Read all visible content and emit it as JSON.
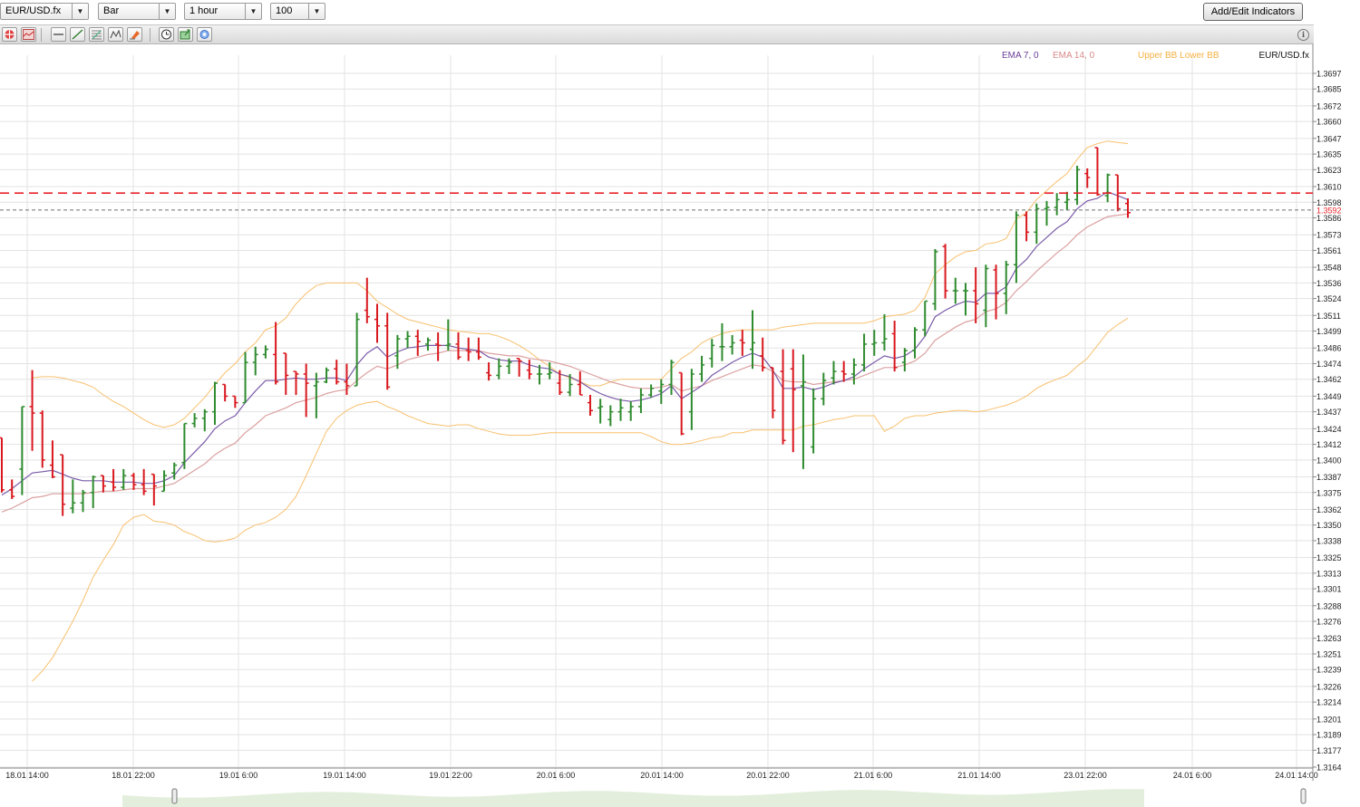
{
  "toolbar": {
    "symbol": "EUR/USD.fx",
    "chart_type": "Bar",
    "interval": "1 hour",
    "bars": "100",
    "add_indicators_label": "Add/Edit Indicators",
    "buttons": [
      "crosshair-icon",
      "line-chart-icon",
      "horizontal-line-icon",
      "trend-line-icon",
      "fibonacci-icon",
      "pattern-icon",
      "eraser-icon",
      "clock-icon",
      "export-icon",
      "settings-icon"
    ]
  },
  "legend": {
    "ema7": "EMA 7, 0",
    "ema14": "EMA 14, 0",
    "bb": "Upper BB Lower BB",
    "symbol": "EUR/USD.fx",
    "ema7_color": "#6a3d9a",
    "ema14_color": "#d98a8a",
    "bb_color": "#f5b041"
  },
  "colors": {
    "up": "#2e8b2e",
    "down": "#d9181e",
    "ema7": "#7b5ba8",
    "ema14": "#dba0a0",
    "bb": "#f8c06e",
    "hline": "#e8232a",
    "current_line": "#707070",
    "grid": "#e3e3e3"
  },
  "chart_data": {
    "type": "ohlc",
    "price_axis_labels": [
      "1.3697",
      "1.3685",
      "1.3672",
      "1.3660",
      "1.3647",
      "1.3635",
      "1.3623",
      "1.3610",
      "1.3598",
      "1.3586",
      "1.3573",
      "1.3561",
      "1.3548",
      "1.3536",
      "1.3524",
      "1.3511",
      "1.3499",
      "1.3486",
      "1.3474",
      "1.3462",
      "1.3449",
      "1.3437",
      "1.3424",
      "1.3412",
      "1.3400",
      "1.3387",
      "1.3375",
      "1.3362",
      "1.3350",
      "1.3338",
      "1.3325",
      "1.3313",
      "1.3301",
      "1.3288",
      "1.3276",
      "1.3263",
      "1.3251",
      "1.3239",
      "1.3226",
      "1.3214",
      "1.3201",
      "1.3189",
      "1.3177",
      "1.3164"
    ],
    "ylim": [
      1.3164,
      1.3697
    ],
    "time_axis_labels": [
      "18.01 14:00",
      "18.01 22:00",
      "19.01 6:00",
      "19.01 14:00",
      "19.01 22:00",
      "20.01 6:00",
      "20.01 14:00",
      "20.01 22:00",
      "21.01 6:00",
      "21.01 14:00",
      "23.01 22:00",
      "24.01 6:00",
      "24.01 14:00"
    ],
    "current_price": "1.3592",
    "current_price_value": 1.3592,
    "horizontal_line": 1.3605,
    "ohlc": [
      [
        1.3417,
        1.3417,
        1.3375,
        1.3377
      ],
      [
        1.3377,
        1.3385,
        1.337,
        1.3372
      ],
      [
        1.3393,
        1.3441,
        1.3373,
        1.3441
      ],
      [
        1.3441,
        1.3469,
        1.3407,
        1.3436
      ],
      [
        1.3436,
        1.3438,
        1.3394,
        1.34
      ],
      [
        1.3396,
        1.3415,
        1.3386,
        1.3387
      ],
      [
        1.3404,
        1.3404,
        1.3357,
        1.3366
      ],
      [
        1.3363,
        1.3385,
        1.3359,
        1.3367
      ],
      [
        1.3367,
        1.3377,
        1.336,
        1.3375
      ],
      [
        1.3375,
        1.3388,
        1.3363,
        1.3387
      ],
      [
        1.3388,
        1.3388,
        1.3375,
        1.338
      ],
      [
        1.3383,
        1.3393,
        1.3376,
        1.3379
      ],
      [
        1.3379,
        1.3393,
        1.3377,
        1.3388
      ],
      [
        1.3388,
        1.339,
        1.3377,
        1.3381
      ],
      [
        1.3381,
        1.3393,
        1.3373,
        1.3376
      ],
      [
        1.3389,
        1.3389,
        1.3365,
        1.338
      ],
      [
        1.3376,
        1.3392,
        1.3376,
        1.3388
      ],
      [
        1.339,
        1.3398,
        1.3385,
        1.3396
      ],
      [
        1.3398,
        1.3428,
        1.3393,
        1.3428
      ],
      [
        1.3428,
        1.3436,
        1.3425,
        1.3432
      ],
      [
        1.3432,
        1.3439,
        1.3422,
        1.3437
      ],
      [
        1.3437,
        1.346,
        1.3427,
        1.3459
      ],
      [
        1.3458,
        1.3458,
        1.3445,
        1.3449
      ],
      [
        1.3449,
        1.3449,
        1.344,
        1.3444
      ],
      [
        1.3444,
        1.3483,
        1.3444,
        1.3475
      ],
      [
        1.3475,
        1.3487,
        1.3465,
        1.3481
      ],
      [
        1.3481,
        1.3488,
        1.3478,
        1.3485
      ],
      [
        1.3481,
        1.3506,
        1.3458,
        1.346
      ],
      [
        1.3482,
        1.3482,
        1.345,
        1.3465
      ],
      [
        1.3468,
        1.3468,
        1.345,
        1.3466
      ],
      [
        1.3466,
        1.3474,
        1.3433,
        1.3459
      ],
      [
        1.3457,
        1.3467,
        1.3432,
        1.346
      ],
      [
        1.346,
        1.3471,
        1.3459,
        1.3469
      ],
      [
        1.347,
        1.3477,
        1.3458,
        1.346
      ],
      [
        1.346,
        1.3474,
        1.345,
        1.3457
      ],
      [
        1.3457,
        1.3513,
        1.3457,
        1.3508
      ],
      [
        1.3515,
        1.354,
        1.3505,
        1.351
      ],
      [
        1.3508,
        1.352,
        1.349,
        1.3503
      ],
      [
        1.3503,
        1.3513,
        1.3454,
        1.3456
      ],
      [
        1.348,
        1.3496,
        1.347,
        1.3493
      ],
      [
        1.3493,
        1.3499,
        1.3486,
        1.3495
      ],
      [
        1.3495,
        1.35,
        1.348,
        1.3491
      ],
      [
        1.3489,
        1.3494,
        1.3484,
        1.3492
      ],
      [
        1.3489,
        1.3498,
        1.3476,
        1.3488
      ],
      [
        1.3488,
        1.3508,
        1.3484,
        1.3489
      ],
      [
        1.3489,
        1.3498,
        1.3477,
        1.3479
      ],
      [
        1.3484,
        1.3494,
        1.3476,
        1.3483
      ],
      [
        1.3483,
        1.3494,
        1.3477,
        1.3479
      ],
      [
        1.3467,
        1.3475,
        1.3461,
        1.3465
      ],
      [
        1.3465,
        1.3478,
        1.3462,
        1.3472
      ],
      [
        1.3472,
        1.3478,
        1.3466,
        1.3475
      ],
      [
        1.3478,
        1.3478,
        1.3464,
        1.3476
      ],
      [
        1.3469,
        1.3477,
        1.3462,
        1.3466
      ],
      [
        1.3466,
        1.3473,
        1.3458,
        1.3466
      ],
      [
        1.3466,
        1.3475,
        1.3462,
        1.3467
      ],
      [
        1.3459,
        1.3469,
        1.345,
        1.3452
      ],
      [
        1.3452,
        1.3466,
        1.3449,
        1.3458
      ],
      [
        1.3458,
        1.3468,
        1.345,
        1.345
      ],
      [
        1.3444,
        1.345,
        1.3434,
        1.3438
      ],
      [
        1.344,
        1.3447,
        1.3428,
        1.3441
      ],
      [
        1.3431,
        1.3442,
        1.3426,
        1.3437
      ],
      [
        1.3437,
        1.3447,
        1.343,
        1.344
      ],
      [
        1.3437,
        1.3445,
        1.343,
        1.3441
      ],
      [
        1.3441,
        1.3455,
        1.3436,
        1.345
      ],
      [
        1.345,
        1.3458,
        1.3448,
        1.3455
      ],
      [
        1.3453,
        1.3462,
        1.3443,
        1.3458
      ],
      [
        1.3458,
        1.3477,
        1.345,
        1.3475
      ],
      [
        1.3467,
        1.3467,
        1.3419,
        1.342
      ],
      [
        1.3437,
        1.347,
        1.3423,
        1.3466
      ],
      [
        1.3466,
        1.348,
        1.346,
        1.3473
      ],
      [
        1.3478,
        1.3493,
        1.3471,
        1.3488
      ],
      [
        1.3487,
        1.3505,
        1.3476,
        1.3487
      ],
      [
        1.3487,
        1.3496,
        1.3481,
        1.349
      ],
      [
        1.3492,
        1.35,
        1.348,
        1.349
      ],
      [
        1.3485,
        1.3515,
        1.347,
        1.349
      ],
      [
        1.348,
        1.3494,
        1.3468,
        1.3471
      ],
      [
        1.3471,
        1.3471,
        1.3432,
        1.3438
      ],
      [
        1.3468,
        1.3485,
        1.3412,
        1.3415
      ],
      [
        1.347,
        1.3485,
        1.3406,
        1.3454
      ],
      [
        1.3457,
        1.3481,
        1.3393,
        1.346
      ],
      [
        1.341,
        1.3455,
        1.3405,
        1.3447
      ],
      [
        1.3447,
        1.3467,
        1.3442,
        1.3461
      ],
      [
        1.3463,
        1.3476,
        1.3458,
        1.3468
      ],
      [
        1.3468,
        1.3476,
        1.346,
        1.3466
      ],
      [
        1.3466,
        1.3478,
        1.3458,
        1.3473
      ]
    ],
    "ema7": [
      1.3373,
      1.3378,
      1.3384,
      1.339,
      1.3391,
      1.3392,
      1.3389,
      1.3386,
      1.3384,
      1.3384,
      1.3384,
      1.3383,
      1.3383,
      1.3383,
      1.3382,
      1.3382,
      1.3384,
      1.3388,
      1.3398,
      1.3406,
      1.3414,
      1.3424,
      1.343,
      1.3434,
      1.3444,
      1.3453,
      1.3461,
      1.3461,
      1.3462,
      1.3463,
      1.3462,
      1.3462,
      1.3463,
      1.3463,
      1.3461,
      1.3473,
      1.3482,
      1.3487,
      1.3479,
      1.3483,
      1.3486,
      1.3487,
      1.3488,
      1.3488,
      1.3488,
      1.3486,
      1.3485,
      1.3484,
      1.3479,
      1.3477,
      1.3476,
      1.3476,
      1.3473,
      1.3471,
      1.347,
      1.3466,
      1.3464,
      1.346,
      1.3455,
      1.3451,
      1.3448,
      1.3446,
      1.3445,
      1.3446,
      1.3448,
      1.3451,
      1.3457,
      1.3447,
      1.3452,
      1.3457,
      1.3465,
      1.347,
      1.3475,
      1.3479,
      1.3482,
      1.3479,
      1.3469,
      1.3455,
      1.3455,
      1.3456,
      1.3454,
      1.3456,
      1.3459,
      1.3461,
      1.3464
    ],
    "ema14": [
      1.336,
      1.3363,
      1.3367,
      1.3371,
      1.3372,
      1.3374,
      1.3374,
      1.3374,
      1.3374,
      1.3375,
      1.3376,
      1.3376,
      1.3377,
      1.3378,
      1.3378,
      1.3378,
      1.338,
      1.3382,
      1.3387,
      1.3392,
      1.3397,
      1.3404,
      1.3409,
      1.3413,
      1.3421,
      1.3427,
      1.3434,
      1.3437,
      1.344,
      1.3444,
      1.3446,
      1.3448,
      1.3451,
      1.3453,
      1.3454,
      1.3461,
      1.3467,
      1.3472,
      1.347,
      1.3473,
      1.3477,
      1.3479,
      1.3481,
      1.3482,
      1.3484,
      1.3484,
      1.3484,
      1.3484,
      1.3482,
      1.3481,
      1.348,
      1.348,
      1.3478,
      1.3477,
      1.3476,
      1.3474,
      1.3472,
      1.3469,
      1.3466,
      1.3463,
      1.346,
      1.3458,
      1.3456,
      1.3455,
      1.3455,
      1.3456,
      1.3458,
      1.3453,
      1.3455,
      1.3457,
      1.3461,
      1.3464,
      1.3467,
      1.347,
      1.3473,
      1.3472,
      1.3468,
      1.3461,
      1.346,
      1.346,
      1.3458,
      1.3459,
      1.346,
      1.3461,
      1.3462
    ],
    "bb_upper": [
      null,
      null,
      null,
      1.3463,
      1.3464,
      1.3464,
      1.3463,
      1.3461,
      1.3459,
      1.3456,
      1.345,
      1.3445,
      1.3441,
      1.3436,
      1.3431,
      1.3427,
      1.3425,
      1.3427,
      1.3432,
      1.344,
      1.3448,
      1.3458,
      1.3467,
      1.3474,
      1.3483,
      1.349,
      1.35,
      1.3503,
      1.3509,
      1.352,
      1.3528,
      1.3534,
      1.3536,
      1.3536,
      1.3536,
      1.3536,
      1.353,
      1.3522,
      1.3517,
      1.3512,
      1.3508,
      1.3506,
      1.3504,
      1.3502,
      1.35,
      1.3499,
      1.3498,
      1.3497,
      1.3497,
      1.3495,
      1.3492,
      1.3488,
      1.3483,
      1.3477,
      1.3472,
      1.3466,
      1.3463,
      1.346,
      1.3457,
      1.3457,
      1.346,
      1.3462,
      1.3462,
      1.3462,
      1.3462,
      1.3462,
      1.347,
      1.3478,
      1.3483,
      1.349,
      1.3494,
      1.3497,
      1.3499,
      1.35,
      1.35,
      1.35,
      1.35,
      1.3502,
      1.3503,
      1.3504,
      1.3505,
      1.3505,
      1.3505,
      1.3505,
      1.3505
    ],
    "bb_lower": [
      null,
      null,
      null,
      1.323,
      1.3238,
      1.3248,
      1.3262,
      1.3276,
      1.3292,
      1.331,
      1.3323,
      1.3335,
      1.335,
      1.3356,
      1.3358,
      1.3353,
      1.3352,
      1.335,
      1.3345,
      1.3342,
      1.3338,
      1.3337,
      1.3338,
      1.334,
      1.3346,
      1.335,
      1.3352,
      1.3356,
      1.3362,
      1.3372,
      1.3388,
      1.3405,
      1.3422,
      1.3432,
      1.3438,
      1.3442,
      1.3444,
      1.3445,
      1.3441,
      1.3438,
      1.3434,
      1.3431,
      1.3428,
      1.3427,
      1.3426,
      1.3427,
      1.3427,
      1.3424,
      1.3422,
      1.342,
      1.3419,
      1.3419,
      1.3419,
      1.342,
      1.3421,
      1.3421,
      1.3421,
      1.3421,
      1.3421,
      1.3421,
      1.3421,
      1.3421,
      1.3421,
      1.3421,
      1.3418,
      1.3414,
      1.3412,
      1.3412,
      1.3413,
      1.3415,
      1.3417,
      1.3418,
      1.3421,
      1.3421,
      1.3423,
      1.3423,
      1.3423,
      1.3423,
      1.3423,
      1.3426,
      1.3427,
      1.3429,
      1.3431,
      1.3432,
      1.3434
    ],
    "ohlc_tail": [
      [
        1.3473,
        1.3497,
        1.3468,
        1.3489
      ],
      [
        1.3489,
        1.35,
        1.348,
        1.349
      ],
      [
        1.349,
        1.3512,
        1.3484,
        1.3493
      ],
      [
        1.3497,
        1.3507,
        1.3468,
        1.3471
      ],
      [
        1.3475,
        1.3486,
        1.3468,
        1.3484
      ],
      [
        1.3484,
        1.3502,
        1.3478,
        1.35
      ],
      [
        1.35,
        1.3522,
        1.3495,
        1.3522
      ],
      [
        1.352,
        1.3562,
        1.3515,
        1.356
      ],
      [
        1.3564,
        1.3566,
        1.3524,
        1.353
      ],
      [
        1.353,
        1.354,
        1.352,
        1.353
      ],
      [
        1.353,
        1.3536,
        1.3511,
        1.353
      ],
      [
        1.353,
        1.3548,
        1.3505,
        1.352
      ],
      [
        1.3515,
        1.355,
        1.3502,
        1.3547
      ],
      [
        1.3546,
        1.355,
        1.3508,
        1.3528
      ],
      [
        1.3528,
        1.3553,
        1.3512,
        1.355
      ],
      [
        1.355,
        1.3591,
        1.3536,
        1.3588
      ],
      [
        1.3588,
        1.3591,
        1.3568,
        1.3575
      ],
      [
        1.3575,
        1.3597,
        1.3566,
        1.3593
      ],
      [
        1.3593,
        1.3599,
        1.358,
        1.3594
      ],
      [
        1.3594,
        1.3605,
        1.3588,
        1.36
      ],
      [
        1.3598,
        1.3606,
        1.3592,
        1.36
      ],
      [
        1.36,
        1.3626,
        1.3596,
        1.3623
      ],
      [
        1.362,
        1.3624,
        1.3609,
        1.3617
      ],
      [
        1.364,
        1.364,
        1.3603,
        1.3604
      ],
      [
        1.3603,
        1.362,
        1.3598,
        1.3619
      ],
      [
        1.3619,
        1.3619,
        1.3591,
        1.3593
      ],
      [
        1.3597,
        1.3601,
        1.3586,
        1.359
      ]
    ],
    "ema7_tail": [
      1.347,
      1.3475,
      1.348,
      1.3478,
      1.348,
      1.3485,
      1.3495,
      1.351,
      1.3515,
      1.3519,
      1.3522,
      1.3521,
      1.3528,
      1.3528,
      1.3533,
      1.3547,
      1.3554,
      1.3564,
      1.3571,
      1.3578,
      1.3583,
      1.3593,
      1.3599,
      1.3601,
      1.3606,
      1.3603,
      1.36
    ],
    "ema14_tail": [
      1.3465,
      1.3468,
      1.3471,
      1.3471,
      1.3473,
      1.3476,
      1.3482,
      1.3492,
      1.3497,
      1.3502,
      1.3506,
      1.3508,
      1.3514,
      1.3516,
      1.3521,
      1.353,
      1.3537,
      1.3545,
      1.3552,
      1.3559,
      1.3565,
      1.3573,
      1.3579,
      1.3583,
      1.3587,
      1.3588,
      1.3589
    ],
    "bb_upper_tail": [
      1.3505,
      1.3507,
      1.351,
      1.3511,
      1.3512,
      1.3515,
      1.3525,
      1.3543,
      1.355,
      1.3556,
      1.356,
      1.3561,
      1.3566,
      1.3567,
      1.357,
      1.3585,
      1.359,
      1.36,
      1.3607,
      1.3614,
      1.362,
      1.3631,
      1.364,
      1.3643,
      1.3645,
      1.3644,
      1.3643
    ],
    "bb_lower_tail": [
      1.3434,
      1.3434,
      1.3422,
      1.3426,
      1.3432,
      1.3434,
      1.3434,
      1.3436,
      1.3437,
      1.3438,
      1.3438,
      1.3437,
      1.3438,
      1.344,
      1.3442,
      1.3445,
      1.3449,
      1.3455,
      1.3459,
      1.3462,
      1.3465,
      1.3472,
      1.3478,
      1.3488,
      1.3498,
      1.3504,
      1.3509
    ]
  }
}
